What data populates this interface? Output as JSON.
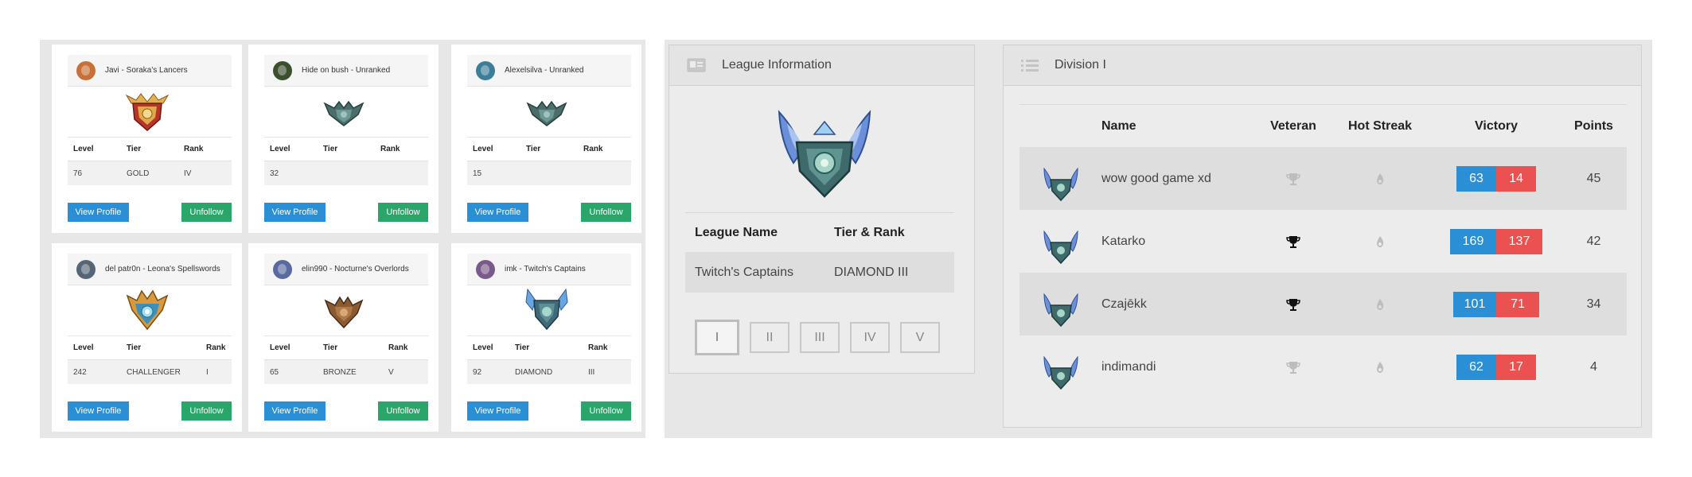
{
  "colors": {
    "accent_blue": "#2b8fd6",
    "accent_green": "#2aa66a",
    "loss_red": "#ea5151",
    "panel_bg": "#e7e7e7"
  },
  "cards": [
    {
      "name": "Javi - Soraka's Lancers",
      "avatar_color": "#c8703a",
      "badge": "gold-crest-icon",
      "level": "76",
      "tier": "GOLD",
      "rank": "IV",
      "view_label": "View Profile",
      "unfollow_label": "Unfollow"
    },
    {
      "name": "Hide on bush - Unranked",
      "avatar_color": "#3a4f2e",
      "badge": "unranked-crest-icon",
      "level": "32",
      "tier": "",
      "rank": "",
      "view_label": "View Profile",
      "unfollow_label": "Unfollow"
    },
    {
      "name": "Alexelsilva - Unranked",
      "avatar_color": "#3c7e9a",
      "badge": "unranked-crest-icon",
      "level": "15",
      "tier": "",
      "rank": "",
      "view_label": "View Profile",
      "unfollow_label": "Unfollow"
    },
    {
      "name": "del patr0n - Leona's Spellswords",
      "avatar_color": "#556677",
      "badge": "challenger-crest-icon",
      "level": "242",
      "tier": "CHALLENGER",
      "rank": "I",
      "view_label": "View Profile",
      "unfollow_label": "Unfollow"
    },
    {
      "name": "elin990 - Nocturne's Overlords",
      "avatar_color": "#5a6aa0",
      "badge": "bronze-crest-icon",
      "level": "65",
      "tier": "BRONZE",
      "rank": "V",
      "view_label": "View Profile",
      "unfollow_label": "Unfollow"
    },
    {
      "name": "imk - Twitch's Captains",
      "avatar_color": "#7a5a8a",
      "badge": "diamond-crest-icon",
      "level": "92",
      "tier": "DIAMOND",
      "rank": "III",
      "view_label": "View Profile",
      "unfollow_label": "Unfollow"
    }
  ],
  "card_headers": {
    "level": "Level",
    "tier": "Tier",
    "rank": "Rank"
  },
  "league": {
    "title": "League Information",
    "icon": "id-card-icon",
    "badge": "diamond-crest-icon",
    "col_name": "League Name",
    "col_tier": "Tier & Rank",
    "name": "Twitch's Captains",
    "tier_rank": "DIAMOND III",
    "pages": [
      "I",
      "II",
      "III",
      "IV",
      "V"
    ],
    "active_page": "I"
  },
  "division": {
    "title": "Division I",
    "icon": "list-icon",
    "headers": {
      "name": "Name",
      "veteran": "Veteran",
      "hot_streak": "Hot Streak",
      "victory": "Victory",
      "points": "Points"
    },
    "rows": [
      {
        "name": "wow good game xd",
        "veteran": false,
        "hot_streak": false,
        "wins": "63",
        "losses": "14",
        "points": "45"
      },
      {
        "name": "Katarko",
        "veteran": true,
        "hot_streak": false,
        "wins": "169",
        "losses": "137",
        "points": "42"
      },
      {
        "name": "Czajēkk",
        "veteran": true,
        "hot_streak": false,
        "wins": "101",
        "losses": "71",
        "points": "34"
      },
      {
        "name": "indimandi",
        "veteran": false,
        "hot_streak": false,
        "wins": "62",
        "losses": "17",
        "points": "4"
      }
    ]
  }
}
